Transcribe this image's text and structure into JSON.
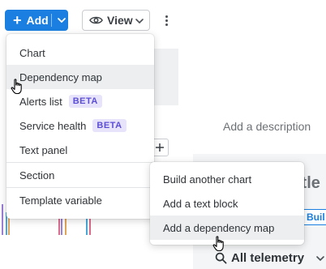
{
  "toolbar": {
    "add_label": "Add",
    "view_label": "View"
  },
  "canvas": {
    "description_placeholder": "Add a description",
    "title_fragment": "itle",
    "build_tab_fragment": "Buil",
    "telemetry_filter": "All telemetry"
  },
  "add_menu": {
    "items": [
      {
        "label": "Chart"
      },
      {
        "label": "Dependency map"
      },
      {
        "label": "Alerts list",
        "badge": "BETA"
      },
      {
        "label": "Service health",
        "badge": "BETA"
      },
      {
        "label": "Text panel"
      },
      {
        "label": "Section"
      },
      {
        "label": "Template variable"
      }
    ]
  },
  "panel_add_menu": {
    "items": [
      {
        "label": "Build another chart"
      },
      {
        "label": "Add a text block"
      },
      {
        "label": "Add a dependency map"
      }
    ]
  },
  "colors": {
    "primary": "#1a7fe0",
    "badge_bg": "#e6e3fb",
    "badge_text": "#5c4fd6",
    "hover_bg": "#eceef0"
  }
}
